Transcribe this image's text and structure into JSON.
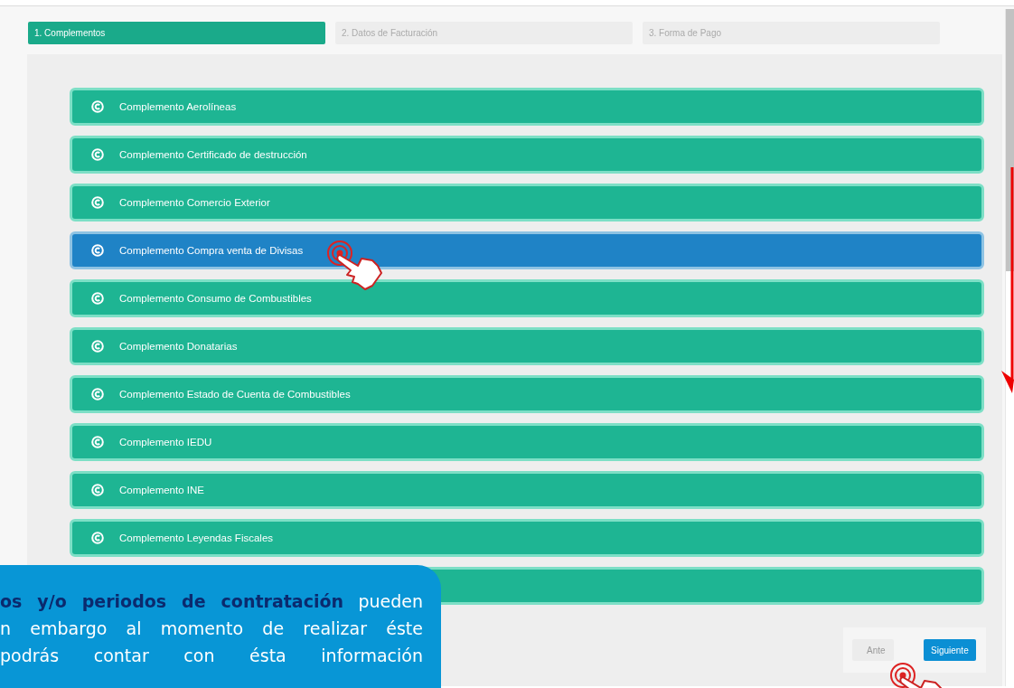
{
  "steps": [
    {
      "label": "1. Complementos",
      "selected": true
    },
    {
      "label": "2. Datos de Facturación",
      "selected": false
    },
    {
      "label": "3. Forma de Pago",
      "selected": false
    }
  ],
  "complements": [
    {
      "label": "Complemento Aerolíneas",
      "selected": false
    },
    {
      "label": "Complemento Certificado de destrucción",
      "selected": false
    },
    {
      "label": "Complemento Comercio Exterior",
      "selected": false
    },
    {
      "label": "Complemento Compra venta de Divisas",
      "selected": true
    },
    {
      "label": "Complemento Consumo de Combustibles",
      "selected": false
    },
    {
      "label": "Complemento Donatarias",
      "selected": false
    },
    {
      "label": "Complemento Estado de Cuenta de Combustibles",
      "selected": false
    },
    {
      "label": "Complemento IEDU",
      "selected": false
    },
    {
      "label": "Complemento INE",
      "selected": false
    },
    {
      "label": "Complemento Leyendas Fiscales",
      "selected": false
    },
    {
      "selected": false
    }
  ],
  "buttons": [
    {
      "label": "Ante",
      "kind": "secondary"
    },
    {
      "label": "Siguiente",
      "kind": "primary"
    }
  ],
  "callout": {
    "lines": [
      "**os y/o periodos de contratación** pueden",
      "n embargo al momento de realizar éste",
      "podrás contar con ésta información"
    ]
  }
}
